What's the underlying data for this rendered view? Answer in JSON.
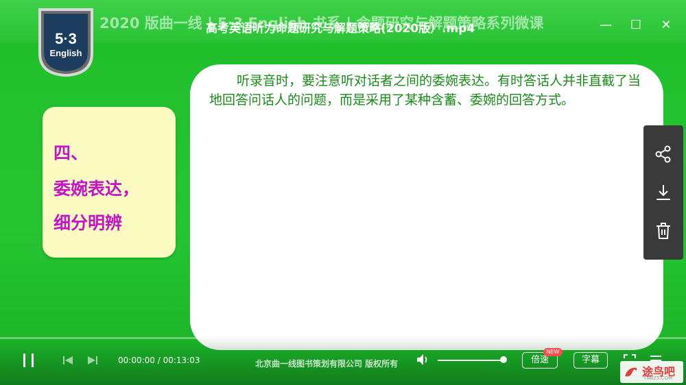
{
  "header": {
    "background_title": "2020 版曲一线 | 5·3 English 书系 | 命题研究与解题策略系列微课",
    "file_title": "高考英语听力命题研究与解题策略(2020版）.mp4"
  },
  "logo": {
    "top": "5·3",
    "bottom": "English"
  },
  "window_controls": {
    "minimize": "—",
    "maximize": "☐",
    "close": "✕"
  },
  "left_card": {
    "lines": [
      "四、",
      "委婉表达，",
      "细分明辨"
    ]
  },
  "right_card": {
    "paragraph": "听录音时，要注意听对话者之间的委婉表达。有时答话人并非直截了当地回答问话人的问题，而是采用了某种含蓄、委婉的回答方式。"
  },
  "side_panel": {
    "items": [
      "share-icon",
      "download-icon",
      "delete-icon"
    ]
  },
  "controls": {
    "time_current": "00:00:00",
    "time_separator": " / ",
    "time_total": "00:13:03",
    "copyright": "北京曲一线图书策划有限公司  版权所有",
    "speed_label": "倍速",
    "new_badge": "NEW",
    "subtitle_label": "字幕",
    "volume_level": 0.95
  },
  "watermark": {
    "text": "途鸟吧",
    "sub": "TNBZ5.COM"
  },
  "colors": {
    "background": "#22c12e",
    "accent_text": "#c414c4",
    "body_text": "#1a8a1a"
  }
}
